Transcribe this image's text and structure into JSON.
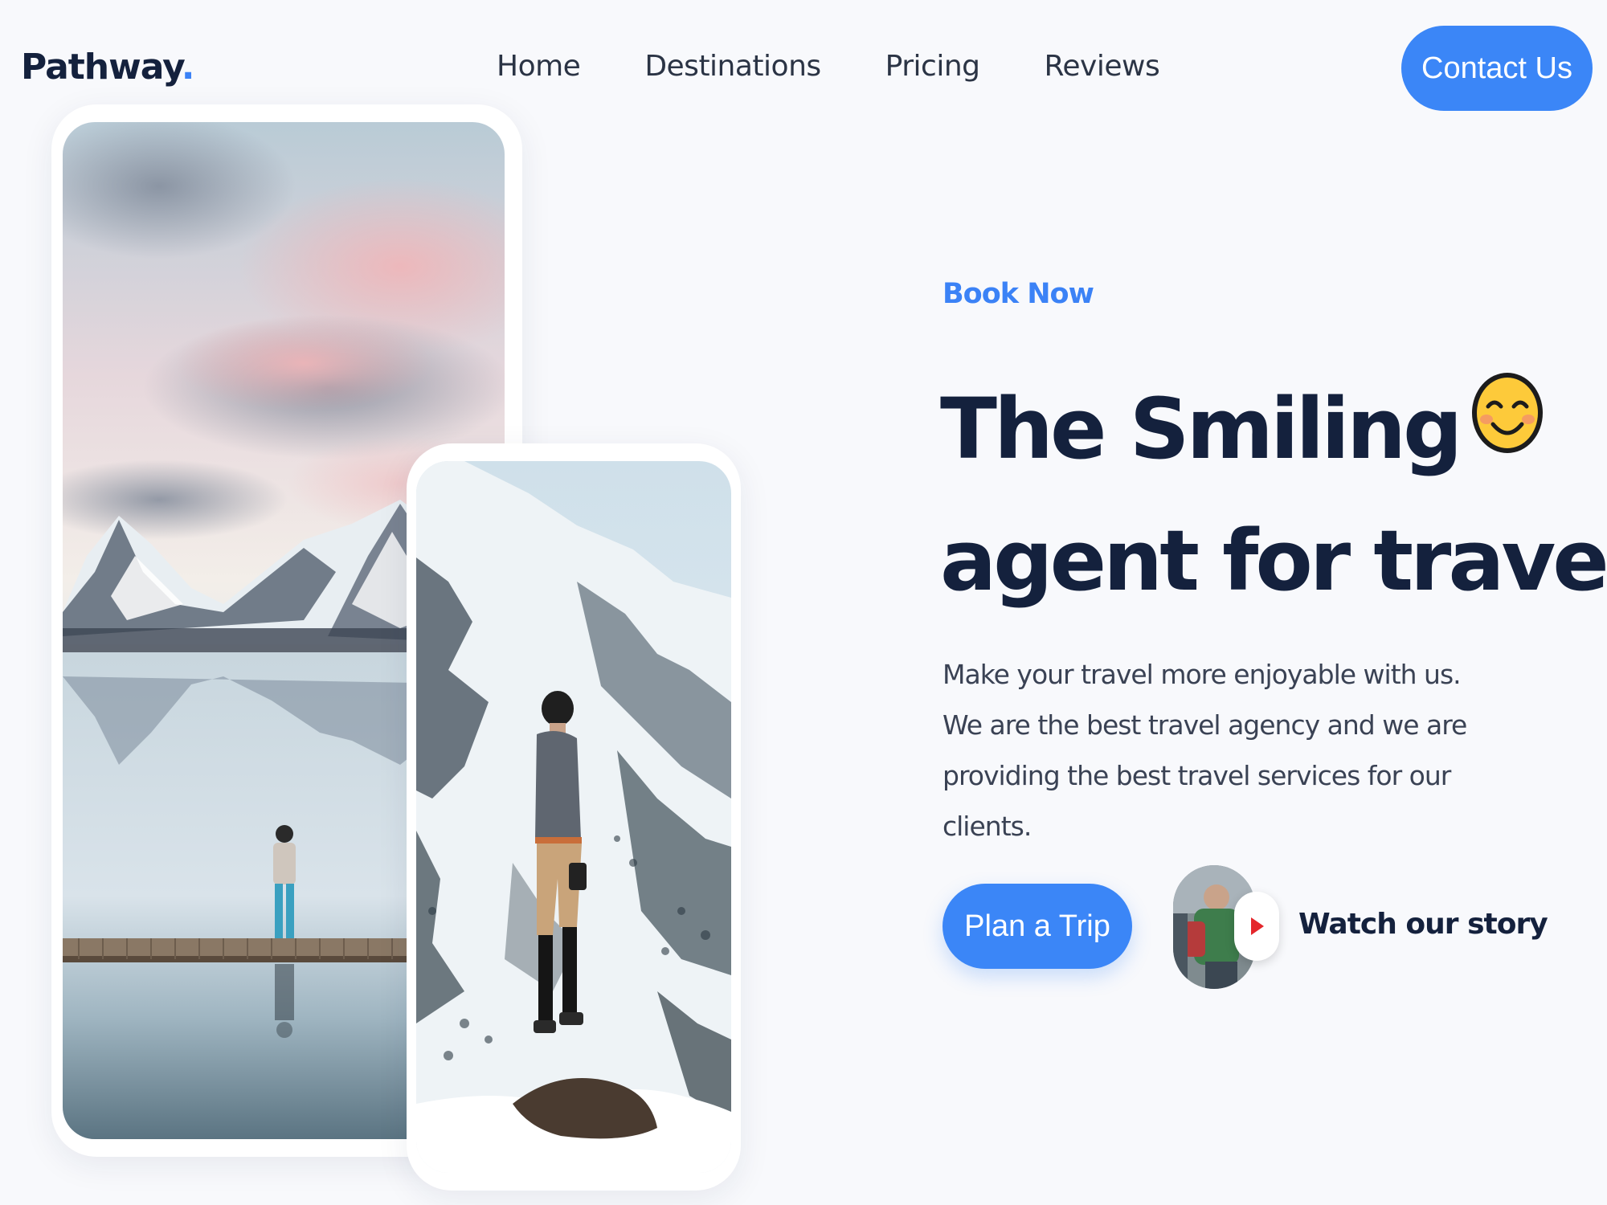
{
  "brand": {
    "name": "Pathway",
    "dot": ".",
    "accent": "#3b82f6"
  },
  "nav": {
    "items": [
      {
        "label": "Home"
      },
      {
        "label": "Destinations"
      },
      {
        "label": "Pricing"
      },
      {
        "label": "Reviews"
      }
    ],
    "contact_label": "Contact Us"
  },
  "hero": {
    "eyebrow": "Book Now",
    "headline_line1": "The Smiling",
    "headline_line2": "agent for travel",
    "emoji": "smiling-face-icon",
    "description": "Make your travel more enjoyable with us. We are the best travel agency and we are providing the best travel services for our clients.",
    "cta_label": "Plan a Trip",
    "story_label": "Watch our story"
  },
  "colors": {
    "primary": "#3b86f7",
    "heading": "#14213d",
    "background": "#f8f9fc"
  }
}
